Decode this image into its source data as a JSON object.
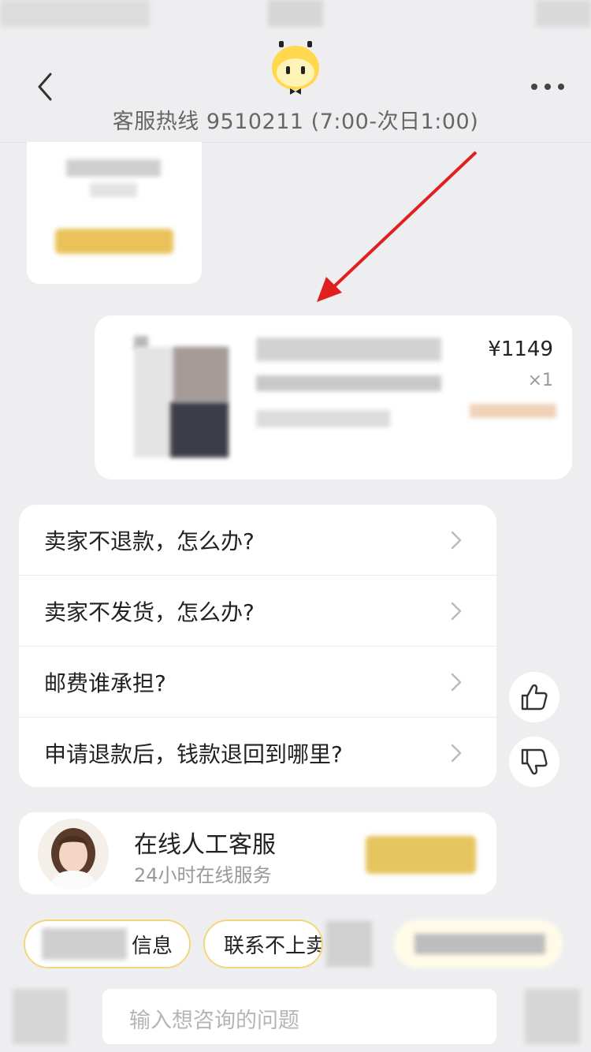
{
  "header": {
    "hotline": "客服热线 9510211 (7:00-次日1:00)"
  },
  "product_card": {
    "price": "¥1149",
    "quantity": "×1"
  },
  "faq": [
    {
      "label": "卖家不退款，怎么办?"
    },
    {
      "label": "卖家不发货，怎么办?"
    },
    {
      "label": "邮费谁承担?"
    },
    {
      "label": "申请退款后，钱款退回到哪里?"
    }
  ],
  "agent": {
    "title": "在线人工客服",
    "subtitle": "24小时在线服务"
  },
  "chips": [
    {
      "label": "信息"
    },
    {
      "label": "联系不上卖"
    }
  ],
  "input": {
    "placeholder": "输入想咨询的问题"
  },
  "icons": {
    "back": "chevron-left-icon",
    "more": "more-horizontal-icon",
    "mascot": "mascot-icon",
    "thumbs_up": "thumbs-up-icon",
    "thumbs_down": "thumbs-down-icon"
  },
  "colors": {
    "accent_yellow": "#ffd84d",
    "background": "#eeeef0",
    "annotation_arrow": "#e02020"
  }
}
